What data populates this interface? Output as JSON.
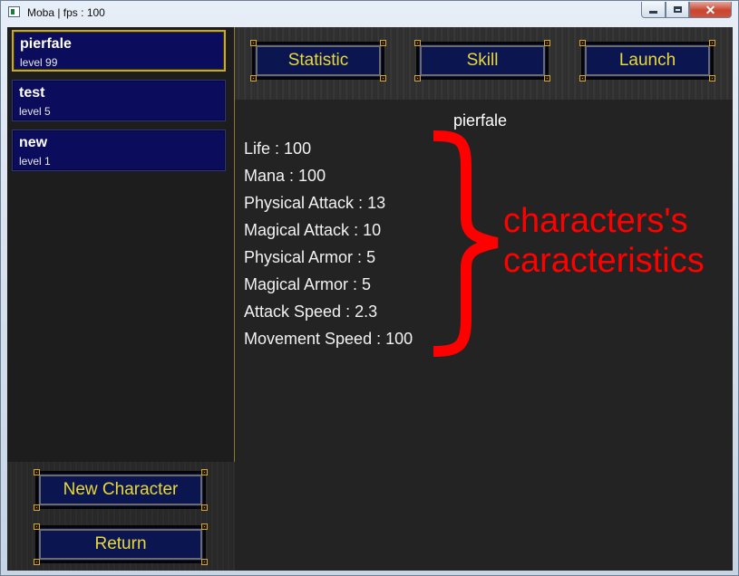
{
  "window": {
    "title": "Moba | fps : 100",
    "close_glyph": "✕"
  },
  "characters": [
    {
      "name": "pierfale",
      "level": "level 99",
      "selected": true
    },
    {
      "name": "test",
      "level": "level 5",
      "selected": false
    },
    {
      "name": "new",
      "level": "level 1",
      "selected": false
    }
  ],
  "tabs": {
    "statistic": "Statistic",
    "skill": "Skill",
    "launch": "Launch"
  },
  "actions": {
    "new_character": "New Character",
    "return": "Return"
  },
  "selected_character": "pierfale",
  "stats": [
    {
      "label": "Life",
      "value": "100"
    },
    {
      "label": "Mana",
      "value": "100"
    },
    {
      "label": "Physical Attack",
      "value": "13"
    },
    {
      "label": "Magical Attack",
      "value": "10"
    },
    {
      "label": "Physical Armor",
      "value": "5"
    },
    {
      "label": "Magical Armor",
      "value": "5"
    },
    {
      "label": "Attack Speed",
      "value": "2.3"
    },
    {
      "label": "Movement Speed",
      "value": "100"
    }
  ],
  "annotation": {
    "line1": "characters's",
    "line2": "caracteristics",
    "color": "#ff0000"
  },
  "colors": {
    "button_bg": "#0b1550",
    "button_text": "#e8d83a",
    "card_bg": "#0b0d5c",
    "selected_border": "#c7a925",
    "panel_bg": "#232323"
  },
  "icons": [
    "app-icon",
    "minimize-icon",
    "maximize-icon",
    "close-icon",
    "curly-brace-annotation"
  ]
}
